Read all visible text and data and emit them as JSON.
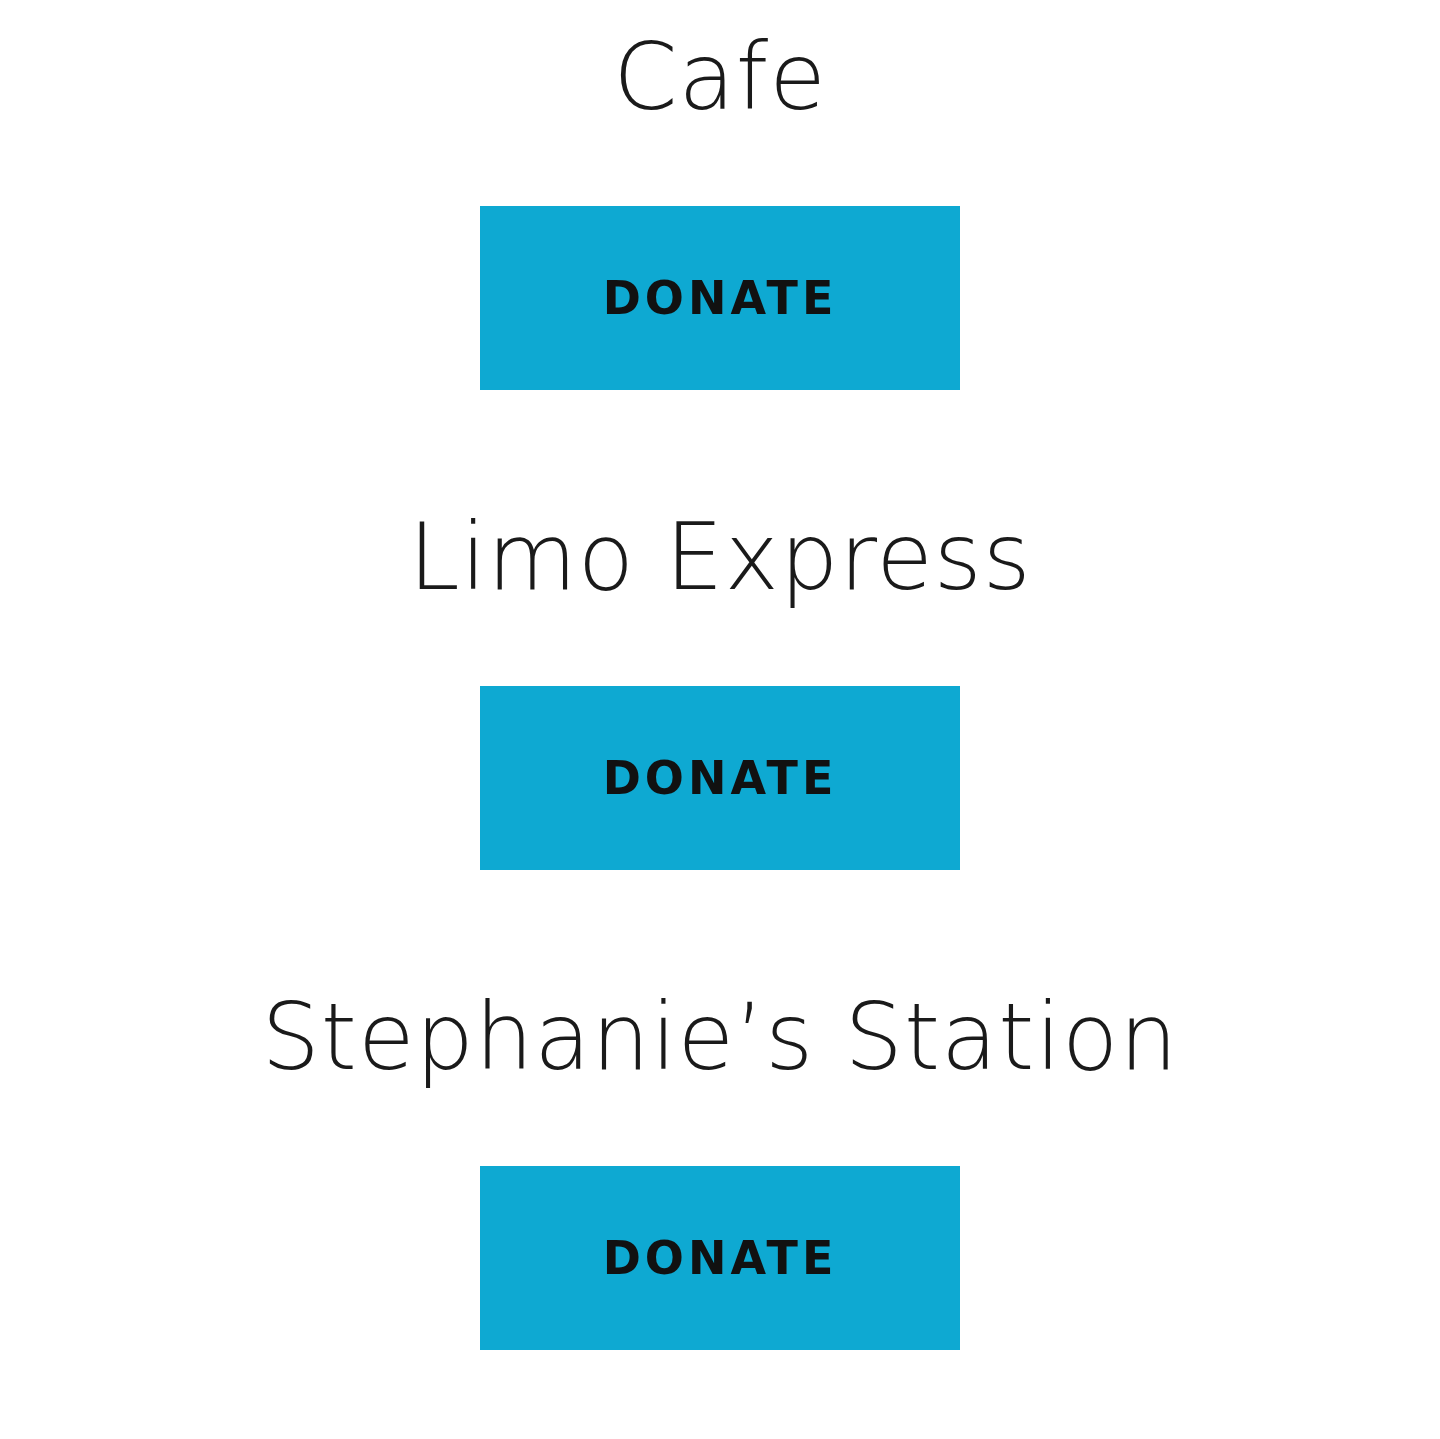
{
  "venues": [
    {
      "name": "Cafe",
      "button": "DONATE"
    },
    {
      "name": "Limo Express",
      "button": "DONATE"
    },
    {
      "name": "Stephanie’s Station",
      "button": "DONATE"
    }
  ]
}
